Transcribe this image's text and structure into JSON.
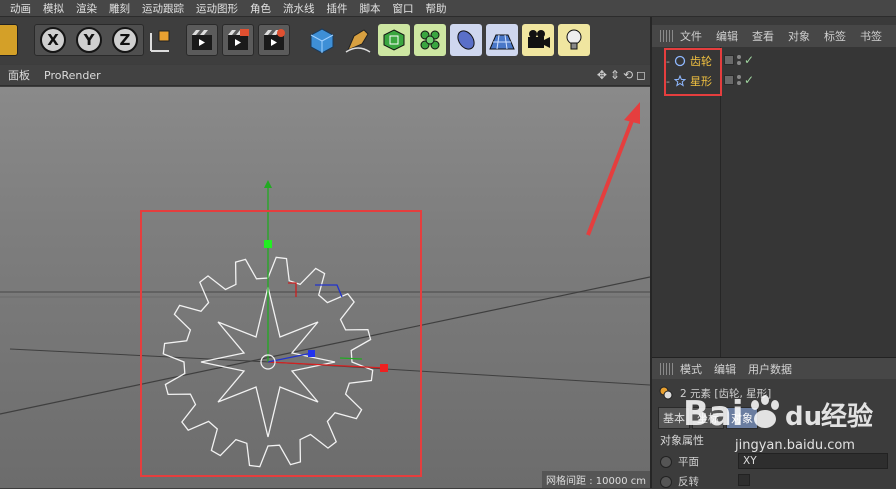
{
  "menu": [
    "动画",
    "模拟",
    "渲染",
    "雕刻",
    "运动跟踪",
    "运动图形",
    "角色",
    "流水线",
    "插件",
    "脚本",
    "窗口",
    "帮助"
  ],
  "toolbar": {
    "axis_x": "X",
    "axis_y": "Y",
    "axis_z": "Z",
    "icons": [
      "snap-icon",
      "axis-x-button",
      "axis-y-button",
      "axis-z-button",
      "coordinate-system-icon",
      "render-region-icon",
      "render-view-icon",
      "render-settings-icon",
      "cube-icon",
      "pen-icon",
      "subdivision-icon",
      "cloner-icon",
      "deformer-icon",
      "floor-icon",
      "camera-icon",
      "light-icon"
    ]
  },
  "viewport_header": {
    "menus": [
      "面板",
      "ProRender"
    ]
  },
  "viewport": {
    "grid_spacing": "网格间距 : 10000 cm"
  },
  "object_manager": {
    "tabs": [
      "文件",
      "编辑",
      "查看",
      "对象",
      "标签",
      "书签"
    ],
    "objects": [
      {
        "name": "齿轮",
        "icon": "circle-icon"
      },
      {
        "name": "星形",
        "icon": "star-icon"
      }
    ]
  },
  "attribute_manager": {
    "tabs": [
      "模式",
      "编辑",
      "用户数据"
    ],
    "selection": "2 元素 [齿轮, 星形]",
    "sub_tabs": [
      "基本",
      "坐标",
      "对象"
    ],
    "section": "对象属性",
    "plane_label": "平面",
    "plane_value": "XY",
    "reverse_label": "反转"
  },
  "watermark": {
    "brand": "Bai",
    "brand2": "du",
    "suffix": "经验",
    "url": "jingyan.baidu.com"
  },
  "colors": {
    "highlight_box": "#e53e3e",
    "object_name": "#f0c040",
    "active_tab": "#6a7da0"
  }
}
